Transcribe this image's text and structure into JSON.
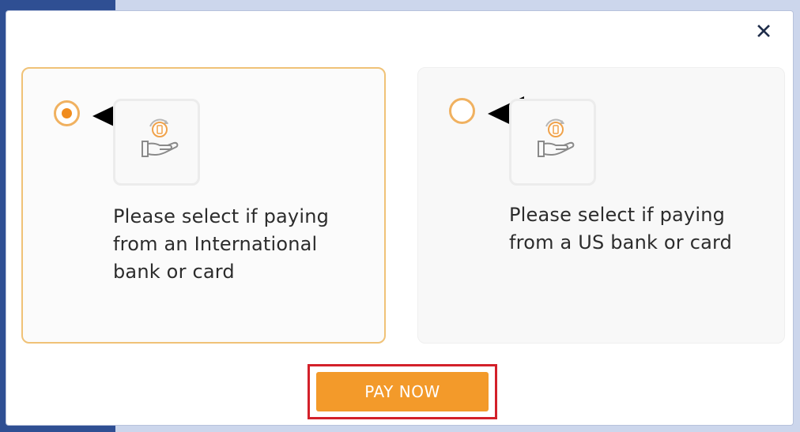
{
  "modal": {
    "close_icon": "close-icon",
    "close_glyph": "✕"
  },
  "options": [
    {
      "id": "international",
      "selected": true,
      "icon": "hand-coin-icon",
      "label": "Please select if paying from an International bank or card"
    },
    {
      "id": "us",
      "selected": false,
      "icon": "hand-coin-icon",
      "label": "Please select if paying from a US bank or card"
    }
  ],
  "pay_button": {
    "label": "PAY NOW"
  },
  "colors": {
    "accent": "#f39a2a",
    "highlight_border": "#d3202a",
    "selected_border": "#f0c277",
    "backdrop": "#ccd6ec"
  }
}
